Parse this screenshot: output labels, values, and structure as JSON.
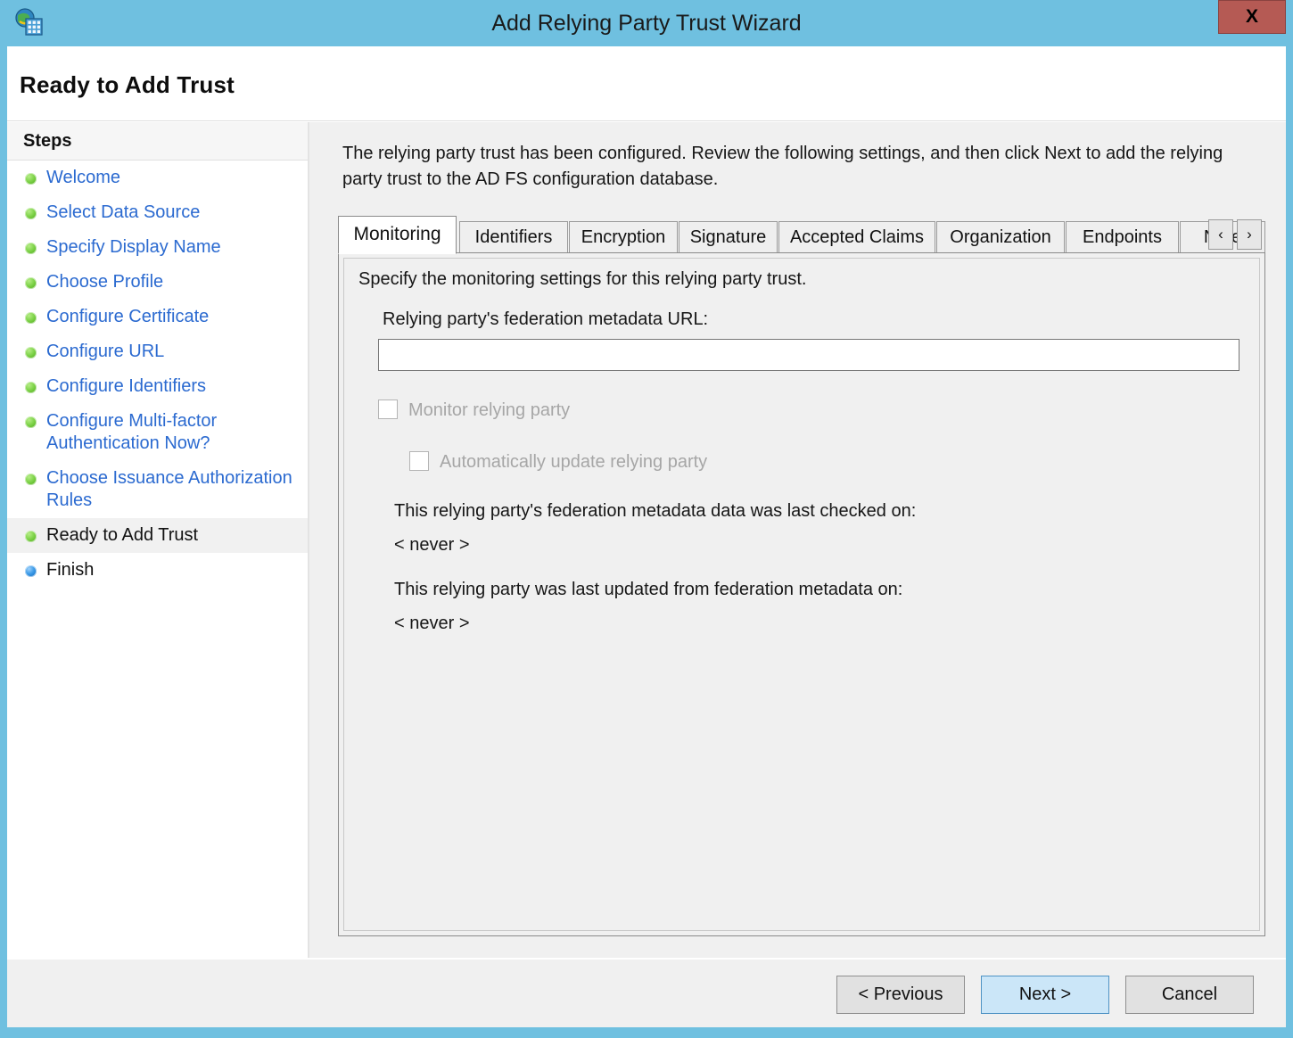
{
  "window": {
    "title": "Add Relying Party Trust Wizard",
    "icon": "globe-building-icon",
    "close_label": "X",
    "chrome_color": "#6fc0e0",
    "close_color": "#b55a54"
  },
  "page": {
    "title": "Ready to Add Trust"
  },
  "sidebar": {
    "heading": "Steps",
    "items": [
      {
        "label": "Welcome",
        "state": "completed",
        "bullet": "green"
      },
      {
        "label": "Select Data Source",
        "state": "completed",
        "bullet": "green"
      },
      {
        "label": "Specify Display Name",
        "state": "completed",
        "bullet": "green"
      },
      {
        "label": "Choose Profile",
        "state": "completed",
        "bullet": "green"
      },
      {
        "label": "Configure Certificate",
        "state": "completed",
        "bullet": "green"
      },
      {
        "label": "Configure URL",
        "state": "completed",
        "bullet": "green"
      },
      {
        "label": "Configure Identifiers",
        "state": "completed",
        "bullet": "green"
      },
      {
        "label": "Configure Multi-factor Authentication Now?",
        "state": "completed",
        "bullet": "green"
      },
      {
        "label": "Choose Issuance Authorization Rules",
        "state": "completed",
        "bullet": "green"
      },
      {
        "label": "Ready to Add Trust",
        "state": "current",
        "bullet": "green"
      },
      {
        "label": "Finish",
        "state": "pending",
        "bullet": "blue"
      }
    ]
  },
  "main": {
    "intro": "The relying party trust has been configured. Review the following settings, and then click Next to add the relying party trust to the AD FS configuration database.",
    "tabs": [
      {
        "label": "Monitoring",
        "active": true
      },
      {
        "label": "Identifiers",
        "active": false
      },
      {
        "label": "Encryption",
        "active": false
      },
      {
        "label": "Signature",
        "active": false
      },
      {
        "label": "Accepted Claims",
        "active": false
      },
      {
        "label": "Organization",
        "active": false
      },
      {
        "label": "Endpoints",
        "active": false
      },
      {
        "label": "Note",
        "active": false
      }
    ],
    "tab_scroll_prev": "‹",
    "tab_scroll_next": "›",
    "monitoring": {
      "description": "Specify the monitoring settings for this relying party trust.",
      "url_label": "Relying party's federation metadata URL:",
      "url_value": "",
      "url_placeholder": "",
      "monitor_checkbox_label": "Monitor relying party",
      "monitor_checkbox_checked": false,
      "monitor_checkbox_enabled": false,
      "autoupdate_checkbox_label": "Automatically update relying party",
      "autoupdate_checkbox_checked": false,
      "autoupdate_checkbox_enabled": false,
      "last_checked_label": "This relying party's federation metadata data was last checked on:",
      "last_checked_value": "< never >",
      "last_updated_label": "This relying party was last updated from federation metadata on:",
      "last_updated_value": "< never >"
    }
  },
  "footer": {
    "previous_label": "< Previous",
    "next_label": "Next >",
    "cancel_label": "Cancel",
    "default_button": "Next >",
    "default_button_color": "#cbe6f8"
  }
}
